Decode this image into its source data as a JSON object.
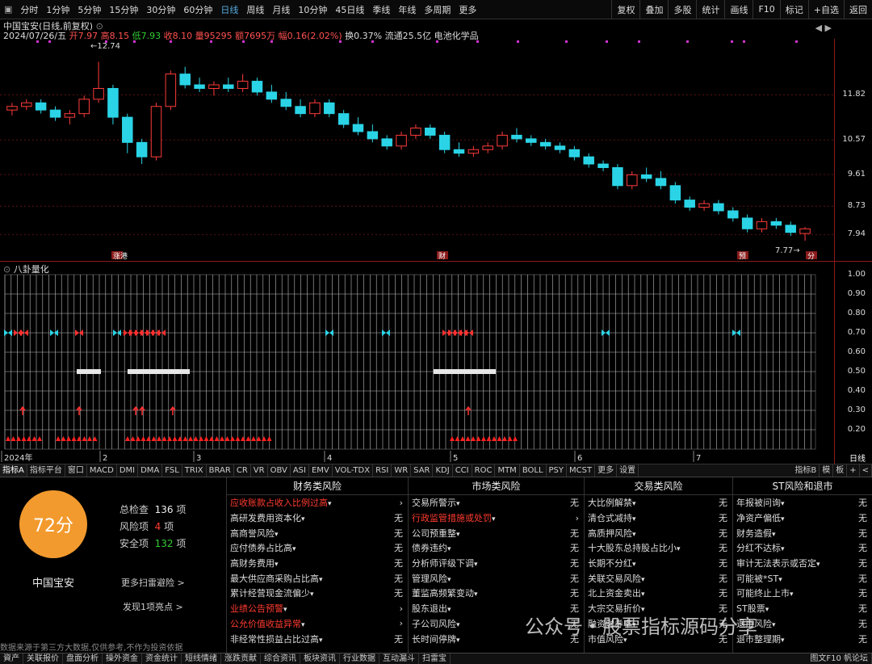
{
  "toolbar": {
    "periods": [
      "分时",
      "1分钟",
      "5分钟",
      "15分钟",
      "30分钟",
      "60分钟",
      "日线",
      "周线",
      "月线",
      "10分钟",
      "45日线",
      "季线",
      "年线",
      "多周期",
      "更多"
    ],
    "active_period": "日线",
    "right": [
      "复权",
      "叠加",
      "多股",
      "统计",
      "画线",
      "F10",
      "标记",
      "+自选",
      "返回"
    ]
  },
  "info": {
    "title": "中国宝安(日线,前复权)",
    "date": "2024/07/26/五",
    "open_label": "开",
    "open": "7.97",
    "high_label": "高",
    "high": "8.15",
    "low_label": "低",
    "low": "7.93",
    "close_label": "收",
    "close": "8.10",
    "vol_label": "量",
    "vol": "95295",
    "amt_label": "额",
    "amt": "7695万",
    "chg_label": "幅",
    "chg": "0.16(2.02%)",
    "turnover": "换0.37%",
    "float": "流通25.5亿",
    "sector": "电池化学品"
  },
  "chart_labels": {
    "max": "12.74",
    "min": "7.77",
    "event1": "涨港",
    "event2": "财",
    "event3": "预",
    "event4": "分"
  },
  "chart_data": {
    "type": "candlestick",
    "yticks": [
      "11.82",
      "10.57",
      "9.61",
      "8.73",
      "7.94"
    ],
    "ylim": [
      7.5,
      13.2
    ],
    "candles": [
      [
        11.4,
        11.6,
        11.25,
        11.5
      ],
      [
        11.5,
        11.7,
        11.4,
        11.6
      ],
      [
        11.6,
        11.7,
        11.3,
        11.4
      ],
      [
        11.4,
        11.5,
        11.1,
        11.2
      ],
      [
        11.2,
        11.4,
        11.0,
        11.3
      ],
      [
        11.3,
        11.8,
        11.2,
        11.7
      ],
      [
        11.7,
        12.74,
        11.6,
        12.0
      ],
      [
        12.0,
        12.1,
        11.0,
        11.2
      ],
      [
        11.2,
        11.3,
        10.2,
        10.5
      ],
      [
        10.5,
        10.6,
        9.9,
        10.1
      ],
      [
        10.1,
        11.6,
        10.0,
        11.5
      ],
      [
        11.5,
        12.5,
        11.4,
        12.4
      ],
      [
        12.4,
        12.6,
        12.0,
        12.1
      ],
      [
        12.1,
        12.3,
        11.9,
        12.0
      ],
      [
        12.0,
        12.2,
        11.8,
        12.1
      ],
      [
        12.1,
        12.3,
        11.9,
        12.0
      ],
      [
        12.0,
        12.4,
        11.9,
        12.2
      ],
      [
        12.2,
        12.3,
        11.8,
        11.9
      ],
      [
        11.9,
        12.1,
        11.6,
        11.7
      ],
      [
        11.7,
        11.9,
        11.4,
        11.5
      ],
      [
        11.5,
        11.7,
        11.2,
        11.3
      ],
      [
        11.3,
        11.7,
        11.2,
        11.6
      ],
      [
        11.6,
        11.7,
        11.2,
        11.3
      ],
      [
        11.3,
        11.4,
        10.9,
        11.0
      ],
      [
        11.0,
        11.2,
        10.7,
        10.8
      ],
      [
        10.8,
        11.0,
        10.5,
        10.6
      ],
      [
        10.6,
        10.7,
        10.3,
        10.4
      ],
      [
        10.4,
        10.8,
        10.3,
        10.7
      ],
      [
        10.7,
        11.0,
        10.6,
        10.9
      ],
      [
        10.9,
        11.0,
        10.6,
        10.7
      ],
      [
        10.7,
        10.8,
        10.2,
        10.3
      ],
      [
        10.3,
        10.5,
        10.1,
        10.2
      ],
      [
        10.2,
        10.4,
        10.1,
        10.3
      ],
      [
        10.3,
        10.5,
        10.2,
        10.4
      ],
      [
        10.4,
        10.8,
        10.3,
        10.7
      ],
      [
        10.7,
        10.9,
        10.5,
        10.6
      ],
      [
        10.6,
        10.7,
        10.4,
        10.5
      ],
      [
        10.5,
        10.6,
        10.3,
        10.4
      ],
      [
        10.4,
        10.5,
        10.2,
        10.3
      ],
      [
        10.3,
        10.4,
        10.0,
        10.1
      ],
      [
        10.1,
        10.2,
        9.8,
        9.9
      ],
      [
        9.9,
        10.0,
        9.7,
        9.8
      ],
      [
        9.8,
        9.9,
        9.2,
        9.3
      ],
      [
        9.3,
        9.7,
        9.2,
        9.6
      ],
      [
        9.6,
        9.8,
        9.4,
        9.5
      ],
      [
        9.5,
        9.7,
        9.2,
        9.3
      ],
      [
        9.3,
        9.4,
        8.8,
        8.9
      ],
      [
        8.9,
        9.0,
        8.6,
        8.7
      ],
      [
        8.7,
        8.9,
        8.6,
        8.8
      ],
      [
        8.8,
        8.9,
        8.5,
        8.6
      ],
      [
        8.6,
        8.7,
        8.3,
        8.4
      ],
      [
        8.4,
        8.5,
        8.0,
        8.1
      ],
      [
        8.1,
        8.4,
        8.0,
        8.3
      ],
      [
        8.3,
        8.4,
        8.1,
        8.2
      ],
      [
        8.2,
        8.3,
        7.9,
        8.0
      ],
      [
        7.97,
        8.15,
        7.77,
        8.1
      ]
    ]
  },
  "indicator": {
    "title": "八卦量化",
    "yticks": [
      "1.00",
      "0.90",
      "0.80",
      "0.70",
      "0.60",
      "0.50",
      "0.40",
      "0.30",
      "0.20"
    ],
    "bottom_label": "日线",
    "xticks": [
      "2024年",
      "2",
      "3",
      "4",
      "5",
      "6",
      "7"
    ]
  },
  "tabs": [
    "指标A",
    "指标平台",
    "窗口",
    "MACD",
    "DMI",
    "DMA",
    "FSL",
    "TRIX",
    "BRAR",
    "CR",
    "VR",
    "OBV",
    "ASI",
    "EMV",
    "VOL-TDX",
    "RSI",
    "WR",
    "SAR",
    "KDJ",
    "CCI",
    "ROC",
    "MTM",
    "BOLL",
    "PSY",
    "MCST",
    "更多",
    "设置"
  ],
  "tabs_right": [
    "指标B",
    "模",
    "板",
    "+",
    "<"
  ],
  "scan": {
    "score": "72分",
    "stock": "中国宝安",
    "total_label": "总检查",
    "total": "136",
    "total_unit": "项",
    "risk_label": "风险项",
    "risk": "4",
    "risk_unit": "项",
    "safe_label": "安全项",
    "safe": "132",
    "safe_unit": "项",
    "more": "更多扫雷避险 >",
    "find": "发现1项亮点 >",
    "disclaimer": "数据来源于第三方大数据,仅供参考,不作为投资依据",
    "cols": [
      {
        "title": "财务类风险",
        "rows": [
          [
            "应收账款占收入比例过高",
            "›",
            true
          ],
          [
            "高研发费用资本化",
            "无",
            false
          ],
          [
            "高商誉风险",
            "无",
            false
          ],
          [
            "应付债券占比高",
            "无",
            false
          ],
          [
            "高财务费用",
            "无",
            false
          ],
          [
            "最大供应商采购占比高",
            "无",
            false
          ],
          [
            "累计经营现金流偏少",
            "无",
            false
          ],
          [
            "业绩公告预警",
            "›",
            true
          ],
          [
            "公允价值收益异常",
            "›",
            true
          ],
          [
            "非经常性损益占比过高",
            "无",
            false
          ]
        ]
      },
      {
        "title": "市场类风险",
        "rows": [
          [
            "交易所警示",
            "无",
            false
          ],
          [
            "行政监管措施或处罚",
            "›",
            true
          ],
          [
            "公司预重整",
            "无",
            false
          ],
          [
            "债券违约",
            "无",
            false
          ],
          [
            "分析师评级下调",
            "无",
            false
          ],
          [
            "管理风险",
            "无",
            false
          ],
          [
            "董监高频繁变动",
            "无",
            false
          ],
          [
            "股东退出",
            "无",
            false
          ],
          [
            "子公司风险",
            "无",
            false
          ],
          [
            "长时间停牌",
            "无",
            false
          ]
        ]
      },
      {
        "title": "交易类风险",
        "rows": [
          [
            "大比例解禁",
            "无",
            false
          ],
          [
            "清仓式减持",
            "无",
            false
          ],
          [
            "高质押风险",
            "无",
            false
          ],
          [
            "十大股东总持股占比小",
            "无",
            false
          ],
          [
            "长期不分红",
            "无",
            false
          ],
          [
            "关联交易风险",
            "无",
            false
          ],
          [
            "北上资金卖出",
            "无",
            false
          ],
          [
            "大宗交易折价",
            "无",
            false
          ],
          [
            "融资融券率",
            "无",
            false
          ],
          [
            "市值风险",
            "无",
            false
          ]
        ]
      },
      {
        "title": "ST风险和退市",
        "rows": [
          [
            "年报被问询",
            "无",
            false
          ],
          [
            "净资产偏低",
            "无",
            false
          ],
          [
            "财务造假",
            "无",
            false
          ],
          [
            "分红不达标",
            "无",
            false
          ],
          [
            "审计无法表示或否定",
            "无",
            false
          ],
          [
            "可能被*ST",
            "无",
            false
          ],
          [
            "可能终止上市",
            "无",
            false
          ],
          [
            "ST股票",
            "无",
            false
          ],
          [
            "退市风险",
            "无",
            false
          ],
          [
            "退市整理期",
            "无",
            false
          ]
        ]
      }
    ]
  },
  "status": [
    "資产",
    "关联报价",
    "盘面分析",
    "操外资金",
    "资金统计",
    "短线情绪",
    "涨跌贡献",
    "综合资讯",
    "板块资讯",
    "行业数据",
    "互动漏斗",
    "扫雷宝"
  ],
  "status_right": "图文F10 帆论坛",
  "watermark": "公众号・股票指标源码分享"
}
